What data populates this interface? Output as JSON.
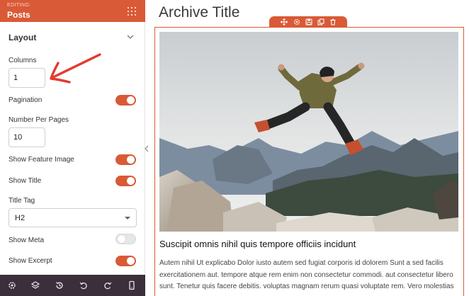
{
  "sidebar": {
    "editing_label": "EDITING:",
    "title": "Posts",
    "section_title": "Layout",
    "columns": {
      "label": "Columns",
      "value": "1"
    },
    "pagination": {
      "label": "Pagination",
      "on": true
    },
    "number_per_pages": {
      "label": "Number Per Pages",
      "value": "10"
    },
    "show_feature_image": {
      "label": "Show Feature Image",
      "on": true
    },
    "show_title": {
      "label": "Show Title",
      "on": true
    },
    "title_tag": {
      "label": "Title Tag",
      "value": "H2"
    },
    "show_meta": {
      "label": "Show Meta",
      "on": false
    },
    "show_excerpt": {
      "label": "Show Excerpt",
      "on": true
    },
    "footer_icons": [
      "settings-icon",
      "layers-icon",
      "history-icon",
      "undo-icon",
      "redo-icon",
      "mobile-preview-icon"
    ],
    "accent_color": "#d95a36",
    "footer_color": "#3b2f3c"
  },
  "main": {
    "archive_title": "Archive Title",
    "toolbar_icons": [
      "move-icon",
      "settings-icon",
      "save-icon",
      "duplicate-icon",
      "delete-icon"
    ],
    "post_title": "Suscipit omnis nihil quis tempore officiis incidunt",
    "excerpt": "Autem nihil Ut explicabo Dolor iusto autem sed fugiat corporis id dolorem Sunt a sed facilis exercitationem aut. tempore atque rem enim non consectetur commodi. aut consectetur libero sunt. Tenetur quis facere debitis. voluptas magnam rerum quasi voluptate rem. Vero molestias"
  }
}
